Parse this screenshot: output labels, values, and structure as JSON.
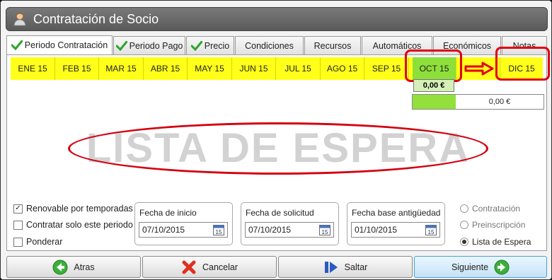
{
  "window": {
    "title": "Contratación de Socio",
    "icon": "user-avatar-icon"
  },
  "tabs": [
    {
      "label": "Periodo Contratación",
      "checked": true,
      "active": true
    },
    {
      "label": "Periodo Pago",
      "checked": true,
      "active": false
    },
    {
      "label": "Precio",
      "checked": true,
      "active": false
    },
    {
      "label": "Condiciones",
      "checked": false,
      "active": false
    },
    {
      "label": "Recursos",
      "checked": false,
      "active": false
    },
    {
      "label": "Automáticos",
      "checked": false,
      "active": false
    },
    {
      "label": "Económicos",
      "checked": false,
      "active": false
    },
    {
      "label": "Notas",
      "checked": false,
      "active": false
    }
  ],
  "months": [
    "ENE 15",
    "FEB 15",
    "MAR 15",
    "ABR 15",
    "MAY 15",
    "JUN 15",
    "JUL 15",
    "AGO 15",
    "SEP 15",
    "OCT 15",
    "",
    "DIC 15"
  ],
  "current_month": "OCT 15",
  "amounts": {
    "month_amount": "0,00 €",
    "total_amount": "0,00 €"
  },
  "waitlist_label": "LISTA DE ESPERA",
  "options": {
    "renovable": {
      "label": "Renovable por temporadas",
      "checked": true
    },
    "solo_periodo": {
      "label": "Contratar solo este periodo",
      "checked": false
    },
    "ponderar": {
      "label": "Ponderar",
      "checked": false
    }
  },
  "dates": {
    "inicio": {
      "label": "Fecha de inicio",
      "value": "07/10/2015"
    },
    "solicitud": {
      "label": "Fecha de solicitud",
      "value": "07/10/2015"
    },
    "antiguedad": {
      "label": "Fecha base antigüedad",
      "value": "01/10/2015"
    }
  },
  "status": {
    "contratacion": {
      "label": "Contratación",
      "selected": false
    },
    "preinscripcion": {
      "label": "Preinscripción",
      "selected": false
    },
    "lista_espera": {
      "label": "Lista de Espera",
      "selected": true
    }
  },
  "footer": {
    "atras": "Atras",
    "cancelar": "Cancelar",
    "saltar": "Saltar",
    "siguiente": "Siguiente"
  },
  "colors": {
    "month_bar": "#ffff1a",
    "current_month": "#8ddf3a",
    "highlight": "#e00010"
  }
}
